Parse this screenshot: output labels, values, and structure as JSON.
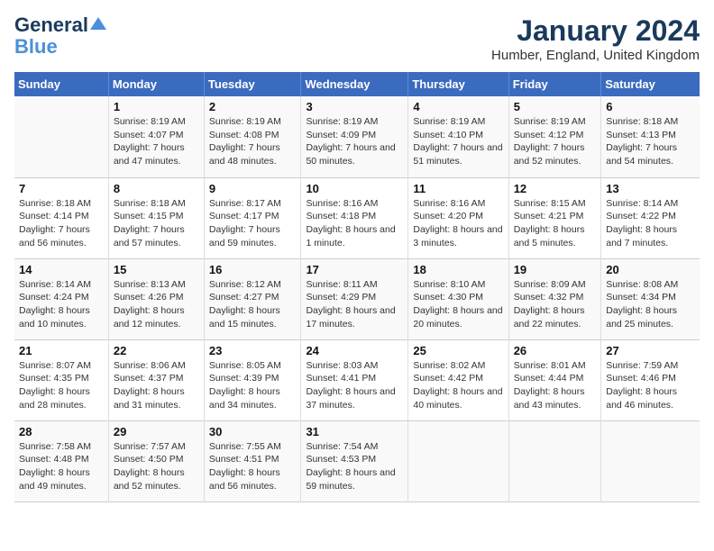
{
  "header": {
    "logo_line1": "General",
    "logo_line2": "Blue",
    "month": "January 2024",
    "location": "Humber, England, United Kingdom"
  },
  "days_of_week": [
    "Sunday",
    "Monday",
    "Tuesday",
    "Wednesday",
    "Thursday",
    "Friday",
    "Saturday"
  ],
  "weeks": [
    [
      {
        "day": "",
        "sunrise": "",
        "sunset": "",
        "daylight": ""
      },
      {
        "day": "1",
        "sunrise": "Sunrise: 8:19 AM",
        "sunset": "Sunset: 4:07 PM",
        "daylight": "Daylight: 7 hours and 47 minutes."
      },
      {
        "day": "2",
        "sunrise": "Sunrise: 8:19 AM",
        "sunset": "Sunset: 4:08 PM",
        "daylight": "Daylight: 7 hours and 48 minutes."
      },
      {
        "day": "3",
        "sunrise": "Sunrise: 8:19 AM",
        "sunset": "Sunset: 4:09 PM",
        "daylight": "Daylight: 7 hours and 50 minutes."
      },
      {
        "day": "4",
        "sunrise": "Sunrise: 8:19 AM",
        "sunset": "Sunset: 4:10 PM",
        "daylight": "Daylight: 7 hours and 51 minutes."
      },
      {
        "day": "5",
        "sunrise": "Sunrise: 8:19 AM",
        "sunset": "Sunset: 4:12 PM",
        "daylight": "Daylight: 7 hours and 52 minutes."
      },
      {
        "day": "6",
        "sunrise": "Sunrise: 8:18 AM",
        "sunset": "Sunset: 4:13 PM",
        "daylight": "Daylight: 7 hours and 54 minutes."
      }
    ],
    [
      {
        "day": "7",
        "sunrise": "Sunrise: 8:18 AM",
        "sunset": "Sunset: 4:14 PM",
        "daylight": "Daylight: 7 hours and 56 minutes."
      },
      {
        "day": "8",
        "sunrise": "Sunrise: 8:18 AM",
        "sunset": "Sunset: 4:15 PM",
        "daylight": "Daylight: 7 hours and 57 minutes."
      },
      {
        "day": "9",
        "sunrise": "Sunrise: 8:17 AM",
        "sunset": "Sunset: 4:17 PM",
        "daylight": "Daylight: 7 hours and 59 minutes."
      },
      {
        "day": "10",
        "sunrise": "Sunrise: 8:16 AM",
        "sunset": "Sunset: 4:18 PM",
        "daylight": "Daylight: 8 hours and 1 minute."
      },
      {
        "day": "11",
        "sunrise": "Sunrise: 8:16 AM",
        "sunset": "Sunset: 4:20 PM",
        "daylight": "Daylight: 8 hours and 3 minutes."
      },
      {
        "day": "12",
        "sunrise": "Sunrise: 8:15 AM",
        "sunset": "Sunset: 4:21 PM",
        "daylight": "Daylight: 8 hours and 5 minutes."
      },
      {
        "day": "13",
        "sunrise": "Sunrise: 8:14 AM",
        "sunset": "Sunset: 4:22 PM",
        "daylight": "Daylight: 8 hours and 7 minutes."
      }
    ],
    [
      {
        "day": "14",
        "sunrise": "Sunrise: 8:14 AM",
        "sunset": "Sunset: 4:24 PM",
        "daylight": "Daylight: 8 hours and 10 minutes."
      },
      {
        "day": "15",
        "sunrise": "Sunrise: 8:13 AM",
        "sunset": "Sunset: 4:26 PM",
        "daylight": "Daylight: 8 hours and 12 minutes."
      },
      {
        "day": "16",
        "sunrise": "Sunrise: 8:12 AM",
        "sunset": "Sunset: 4:27 PM",
        "daylight": "Daylight: 8 hours and 15 minutes."
      },
      {
        "day": "17",
        "sunrise": "Sunrise: 8:11 AM",
        "sunset": "Sunset: 4:29 PM",
        "daylight": "Daylight: 8 hours and 17 minutes."
      },
      {
        "day": "18",
        "sunrise": "Sunrise: 8:10 AM",
        "sunset": "Sunset: 4:30 PM",
        "daylight": "Daylight: 8 hours and 20 minutes."
      },
      {
        "day": "19",
        "sunrise": "Sunrise: 8:09 AM",
        "sunset": "Sunset: 4:32 PM",
        "daylight": "Daylight: 8 hours and 22 minutes."
      },
      {
        "day": "20",
        "sunrise": "Sunrise: 8:08 AM",
        "sunset": "Sunset: 4:34 PM",
        "daylight": "Daylight: 8 hours and 25 minutes."
      }
    ],
    [
      {
        "day": "21",
        "sunrise": "Sunrise: 8:07 AM",
        "sunset": "Sunset: 4:35 PM",
        "daylight": "Daylight: 8 hours and 28 minutes."
      },
      {
        "day": "22",
        "sunrise": "Sunrise: 8:06 AM",
        "sunset": "Sunset: 4:37 PM",
        "daylight": "Daylight: 8 hours and 31 minutes."
      },
      {
        "day": "23",
        "sunrise": "Sunrise: 8:05 AM",
        "sunset": "Sunset: 4:39 PM",
        "daylight": "Daylight: 8 hours and 34 minutes."
      },
      {
        "day": "24",
        "sunrise": "Sunrise: 8:03 AM",
        "sunset": "Sunset: 4:41 PM",
        "daylight": "Daylight: 8 hours and 37 minutes."
      },
      {
        "day": "25",
        "sunrise": "Sunrise: 8:02 AM",
        "sunset": "Sunset: 4:42 PM",
        "daylight": "Daylight: 8 hours and 40 minutes."
      },
      {
        "day": "26",
        "sunrise": "Sunrise: 8:01 AM",
        "sunset": "Sunset: 4:44 PM",
        "daylight": "Daylight: 8 hours and 43 minutes."
      },
      {
        "day": "27",
        "sunrise": "Sunrise: 7:59 AM",
        "sunset": "Sunset: 4:46 PM",
        "daylight": "Daylight: 8 hours and 46 minutes."
      }
    ],
    [
      {
        "day": "28",
        "sunrise": "Sunrise: 7:58 AM",
        "sunset": "Sunset: 4:48 PM",
        "daylight": "Daylight: 8 hours and 49 minutes."
      },
      {
        "day": "29",
        "sunrise": "Sunrise: 7:57 AM",
        "sunset": "Sunset: 4:50 PM",
        "daylight": "Daylight: 8 hours and 52 minutes."
      },
      {
        "day": "30",
        "sunrise": "Sunrise: 7:55 AM",
        "sunset": "Sunset: 4:51 PM",
        "daylight": "Daylight: 8 hours and 56 minutes."
      },
      {
        "day": "31",
        "sunrise": "Sunrise: 7:54 AM",
        "sunset": "Sunset: 4:53 PM",
        "daylight": "Daylight: 8 hours and 59 minutes."
      },
      {
        "day": "",
        "sunrise": "",
        "sunset": "",
        "daylight": ""
      },
      {
        "day": "",
        "sunrise": "",
        "sunset": "",
        "daylight": ""
      },
      {
        "day": "",
        "sunrise": "",
        "sunset": "",
        "daylight": ""
      }
    ]
  ]
}
